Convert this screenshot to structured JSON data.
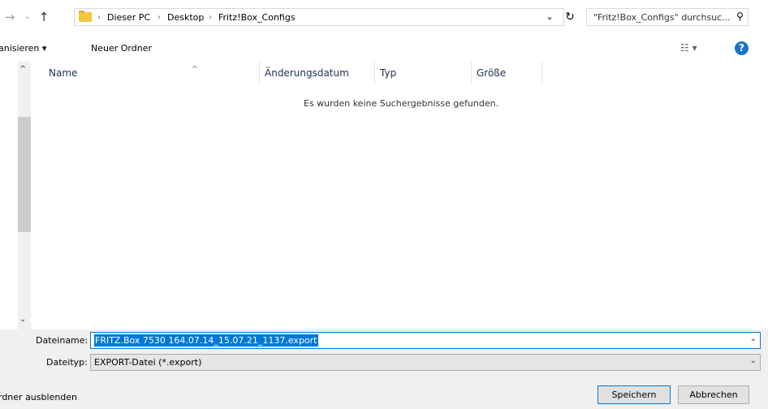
{
  "addressbar": {
    "back_icon": "arrow-right-icon",
    "path": [
      "Dieser PC",
      "Desktop",
      "Fritz!Box_Configs"
    ],
    "search_placeholder": "\"Fritz!Box_Configs\" durchsuc..."
  },
  "toolbar": {
    "organize_label": "anisieren ▾",
    "new_folder_label": "Neuer Ordner",
    "help_label": "?"
  },
  "columns": [
    "Name",
    "Änderungsdatum",
    "Typ",
    "Größe"
  ],
  "empty_message": "Es wurden keine Suchergebnisse gefunden.",
  "form": {
    "filename_label": "Dateiname:",
    "filename_value": "FRITZ.Box 7530 164.07.14_15.07.21_1137.export",
    "filetype_label": "Dateityp:",
    "filetype_value": "EXPORT-Datei (*.export)"
  },
  "footer": {
    "hide_folders_label": "rdner ausblenden",
    "save_label": "Speichern",
    "cancel_label": "Abbrechen"
  },
  "colors": {
    "accent": "#0078d7",
    "help": "#1a73c9",
    "folder": "#f4c542"
  }
}
